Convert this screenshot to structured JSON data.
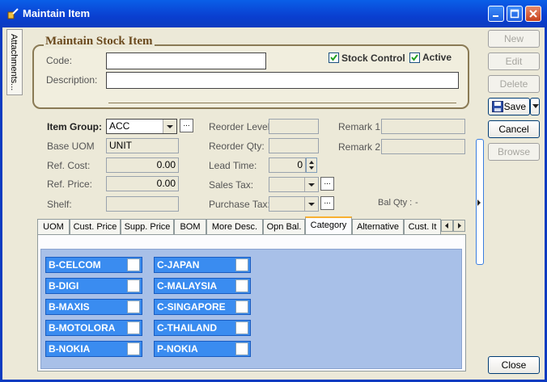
{
  "window": {
    "title": "Maintain Item"
  },
  "side_tab": {
    "label": "Attachments..."
  },
  "group": {
    "title": "Maintain Stock Item",
    "code_label": "Code:",
    "code_value": "",
    "description_label": "Description:",
    "description_value": "",
    "stock_control_label": "Stock Control",
    "stock_control_checked": true,
    "active_label": "Active",
    "active_checked": true
  },
  "fields": {
    "item_group_label": "Item Group:",
    "item_group_value": "ACC",
    "base_uom_label": "Base UOM",
    "base_uom_value": "UNIT",
    "ref_cost_label": "Ref. Cost:",
    "ref_cost_value": "0.00",
    "ref_price_label": "Ref. Price:",
    "ref_price_value": "0.00",
    "shelf_label": "Shelf:",
    "shelf_value": "",
    "reorder_level_label": "Reorder Level:",
    "reorder_level_value": "",
    "reorder_qty_label": "Reorder Qty:",
    "reorder_qty_value": "",
    "lead_time_label": "Lead Time:",
    "lead_time_value": "0",
    "sales_tax_label": "Sales Tax:",
    "sales_tax_value": "",
    "purchase_tax_label": "Purchase Tax:",
    "purchase_tax_value": "",
    "remark1_label": "Remark 1:",
    "remark1_value": "",
    "remark2_label": "Remark 2:",
    "remark2_value": "",
    "bal_qty_label": "Bal Qty :",
    "bal_qty_value": "-",
    "ellipsis": "..."
  },
  "buttons": {
    "new": "New",
    "edit": "Edit",
    "delete": "Delete",
    "save": "Save",
    "cancel": "Cancel",
    "browse": "Browse",
    "close": "Close"
  },
  "tabs": [
    "UOM",
    "Cust. Price",
    "Supp. Price",
    "BOM",
    "More Desc.",
    "Opn Bal.",
    "Category",
    "Alternative",
    "Cust. It"
  ],
  "active_tab": "Category",
  "categories_left": [
    "B-CELCOM",
    "B-DIGI",
    "B-MAXIS",
    "B-MOTOLORA",
    "B-NOKIA"
  ],
  "categories_right": [
    "C-JAPAN",
    "C-MALAYSIA",
    "C-SINGAPORE",
    "C-THAILAND",
    "P-NOKIA"
  ],
  "colors": {
    "title_bar": "#0A5FE8",
    "category_bg": "#3A8CF0",
    "panel_bg": "#A8C0E8"
  }
}
